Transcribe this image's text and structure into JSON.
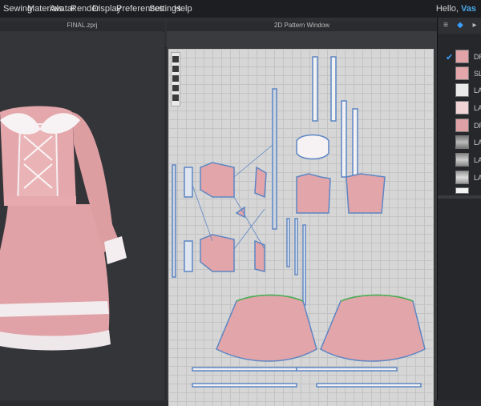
{
  "menu": {
    "items": [
      "Sewing",
      "Materials",
      "Avatar",
      "Render",
      "Display",
      "Preferences",
      "Settings",
      "Help"
    ],
    "greeting": "Hello,",
    "user": "Vas"
  },
  "window_3d": {
    "title": "FINAL.zprj"
  },
  "window_2d": {
    "title": "2D Pattern Window"
  },
  "object_browser": {
    "fabrics": [
      {
        "name": "DRE",
        "swatch": "#e1a3a7",
        "checked": true
      },
      {
        "name": "SLE",
        "swatch": "#e3a7ab",
        "checked": false
      },
      {
        "name": "LAC",
        "swatch": "#e9e9e9",
        "checked": false
      },
      {
        "name": "LAC",
        "swatch": "#f0d4d6",
        "checked": false
      },
      {
        "name": "DRE",
        "swatch": "#dea1a5",
        "checked": false
      },
      {
        "name": "LAC",
        "swatch": "#8e8e8e",
        "checked": false
      },
      {
        "name": "LAC",
        "swatch": "#a6a6a6",
        "checked": false
      },
      {
        "name": "LAC",
        "swatch": "#bdbdbd",
        "checked": false
      },
      {
        "name": "",
        "swatch": "#f3f3f3",
        "checked": false
      }
    ]
  },
  "colors": {
    "fabric_pink": "#e2a5a9",
    "seam_blue": "#5d86c4",
    "lace_white": "#f2ecee",
    "accent_blue": "#3aa0ff"
  }
}
